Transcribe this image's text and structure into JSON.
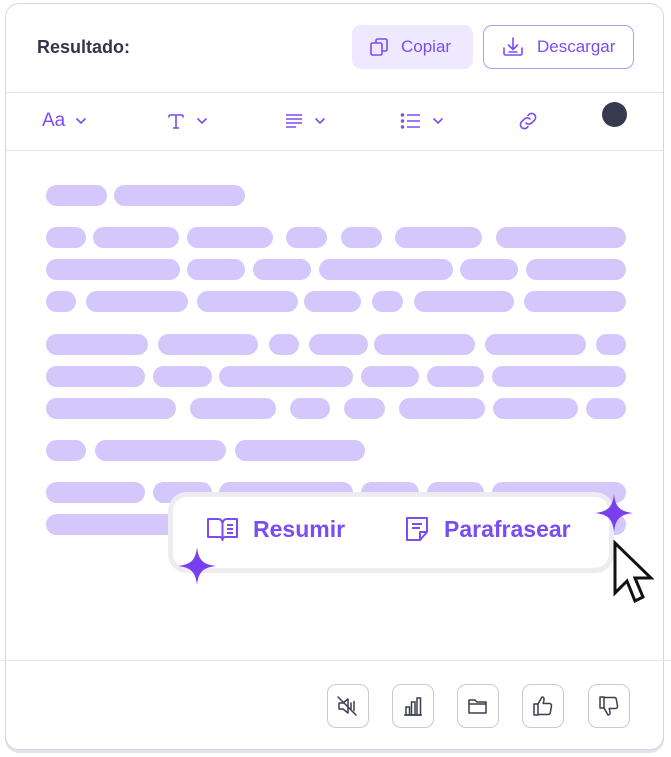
{
  "header": {
    "title": "Resultado:",
    "copy_label": "Copiar",
    "download_label": "Descargar"
  },
  "toolbar": {
    "font_label": "Aa",
    "items": [
      "font-size",
      "text-style",
      "align",
      "list",
      "link",
      "color"
    ],
    "text_color": "#353a4f"
  },
  "popup": {
    "summarize_label": "Resumir",
    "paraphrase_label": "Parafrasear"
  },
  "footer": {
    "buttons": [
      "mute",
      "stats",
      "folder",
      "thumbs-up",
      "thumbs-down"
    ]
  },
  "colors": {
    "accent": "#7b4cf0",
    "placeholder": "#d3c7fb",
    "sparkle": "#7a3ff0"
  }
}
